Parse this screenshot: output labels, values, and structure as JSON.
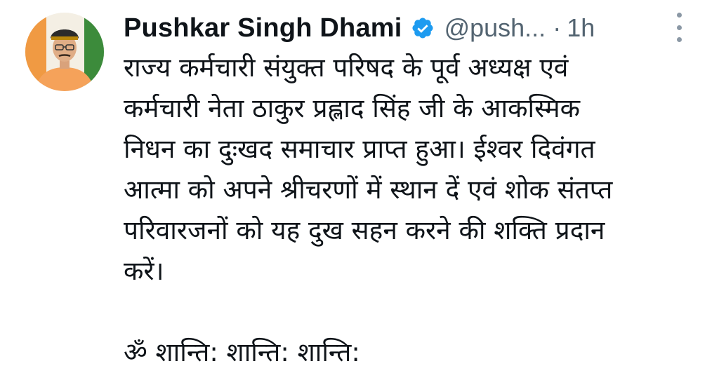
{
  "tweet": {
    "author_name": "Pushkar Singh Dhami",
    "handle": "@push...",
    "separator": "·",
    "time": "1h",
    "verified_icon": "verified-badge-icon",
    "more_icon": "more-vertical-icon",
    "accent_color": "#1d9bf0",
    "body_lines": [
      "राज्य कर्मचारी संयुक्त परिषद के पूर्व अध्यक्ष एवं",
      "कर्मचारी नेता ठाकुर प्रह्लाद सिंह जी के आकस्मिक",
      "निधन का दुःखद समाचार प्राप्त हुआ। ईश्वर दिवंगत",
      "आत्मा को अपने श्रीचरणों में स्थान दें एवं शोक संतप्त",
      "परिवारजनों को यह दुख सहन करने की शक्ति प्रदान",
      "करें।"
    ],
    "closing_line": "ॐ शान्ति: शान्ति: शान्ति:"
  }
}
